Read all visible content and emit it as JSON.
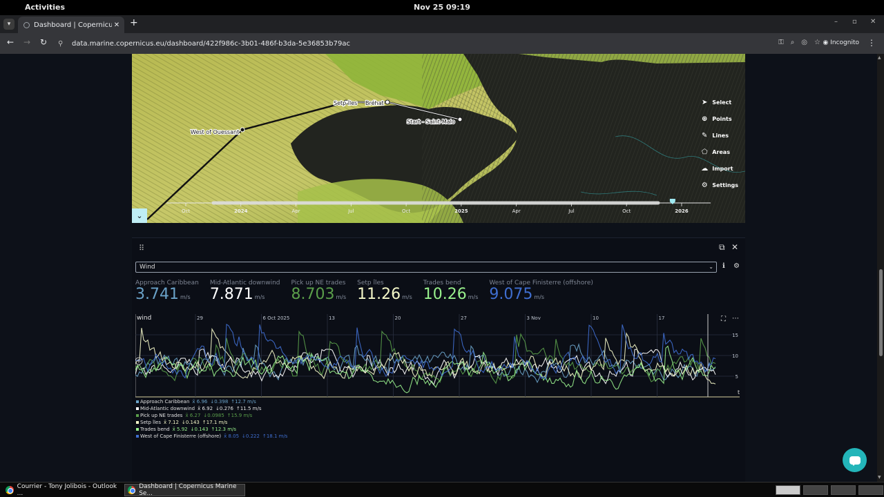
{
  "system": {
    "activities": "Activities",
    "clock": "Nov 25  09:19"
  },
  "browser": {
    "tab_title": "Dashboard | Copernicus Marine",
    "url": "data.marine.copernicus.eu/dashboard/422f986c-3b01-486f-b3da-5e36853b79ac",
    "incognito_label": "Incognito"
  },
  "map": {
    "waypoints": [
      "West of Ouessant",
      "Setp îles",
      "Bréhat",
      "Start - Saint-Malo"
    ],
    "tools": [
      {
        "label": "Select",
        "icon": "cursor-icon"
      },
      {
        "label": "Points",
        "icon": "crosshair-icon"
      },
      {
        "label": "Lines",
        "icon": "pencil-icon"
      },
      {
        "label": "Areas",
        "icon": "polygon-icon"
      },
      {
        "label": "Import",
        "icon": "cloud-upload-icon"
      },
      {
        "label": "Settings",
        "icon": "gear-icon"
      }
    ],
    "timeline_labels": [
      "Oct",
      "2024",
      "Apr",
      "Jul",
      "Oct",
      "2025",
      "Apr",
      "Jul",
      "Oct",
      "2026"
    ],
    "timeline_position": 0.93
  },
  "panel": {
    "variable": "Wind",
    "stats": [
      {
        "name": "Approach Caribbean",
        "value": "3.741",
        "unit": "m/s",
        "color": "#6aa2c8"
      },
      {
        "name": "Mid-Atlantic downwind",
        "value": "7.871",
        "unit": "m/s",
        "color": "#ffffff"
      },
      {
        "name": "Pick up NE trades",
        "value": "8.703",
        "unit": "m/s",
        "color": "#5a9e4a"
      },
      {
        "name": "Setp îles",
        "value": "11.26",
        "unit": "m/s",
        "color": "#f4f7c8"
      },
      {
        "name": "Trades bend",
        "value": "10.26",
        "unit": "m/s",
        "color": "#98f08c"
      },
      {
        "name": "West of Cape Finisterre (offshore)",
        "value": "9.075",
        "unit": "m/s",
        "color": "#3f6ed0"
      }
    ],
    "legend": [
      {
        "name": "Approach Caribbean",
        "mean": "x̄ 6.96",
        "min": "↓0.398",
        "max": "↑12.7 m/s",
        "color": "#6aa2c8",
        "stat_color": "#6aa2c8"
      },
      {
        "name": "Mid-Atlantic downwind",
        "mean": "x̄ 6.92",
        "min": "↓0.276",
        "max": "↑11.5 m/s",
        "color": "#ffffff",
        "stat_color": "#e8e8e8"
      },
      {
        "name": "Pick up NE trades",
        "mean": "x̄ 6.27",
        "min": "↓0.0985",
        "max": "↑15.9 m/s",
        "color": "#5a9e4a",
        "stat_color": "#5a9e4a"
      },
      {
        "name": "Setp îles",
        "mean": "x̄ 7.12",
        "min": "↓0.143",
        "max": "↑17.1 m/s",
        "color": "#f4f7c8",
        "stat_color": "#f4f7c8"
      },
      {
        "name": "Trades bend",
        "mean": "x̄ 5.92",
        "min": "↓0.143",
        "max": "↑12.3 m/s",
        "color": "#98f08c",
        "stat_color": "#98f08c"
      },
      {
        "name": "West of Cape Finisterre (offshore)",
        "mean": "x̄ 8.05",
        "min": "↓0.222",
        "max": "↑18.1 m/s",
        "color": "#3f6ed0",
        "stat_color": "#3f6ed0"
      }
    ]
  },
  "chart_data": {
    "type": "line",
    "title": "wind",
    "x_tick_labels": [
      "29",
      "6 Oct 2025",
      "13",
      "20",
      "27",
      "3 Nov",
      "10",
      "17"
    ],
    "y_ticks": [
      5,
      10,
      15
    ],
    "ylim": [
      0,
      20
    ],
    "ylabel": "",
    "time_label": "t",
    "series_colors": [
      "#6aa2c8",
      "#ffffff",
      "#5a9e4a",
      "#f4f7c8",
      "#98f08c",
      "#3f6ed0"
    ],
    "series_means": [
      6.96,
      6.92,
      6.27,
      7.12,
      5.92,
      8.05
    ],
    "series_max": [
      12.7,
      11.5,
      15.9,
      17.1,
      12.3,
      18.1
    ]
  },
  "taskbar": {
    "items": [
      "Courrier - Tony Jolibois - Outlook ...",
      "Dashboard | Copernicus Marine Se..."
    ]
  }
}
